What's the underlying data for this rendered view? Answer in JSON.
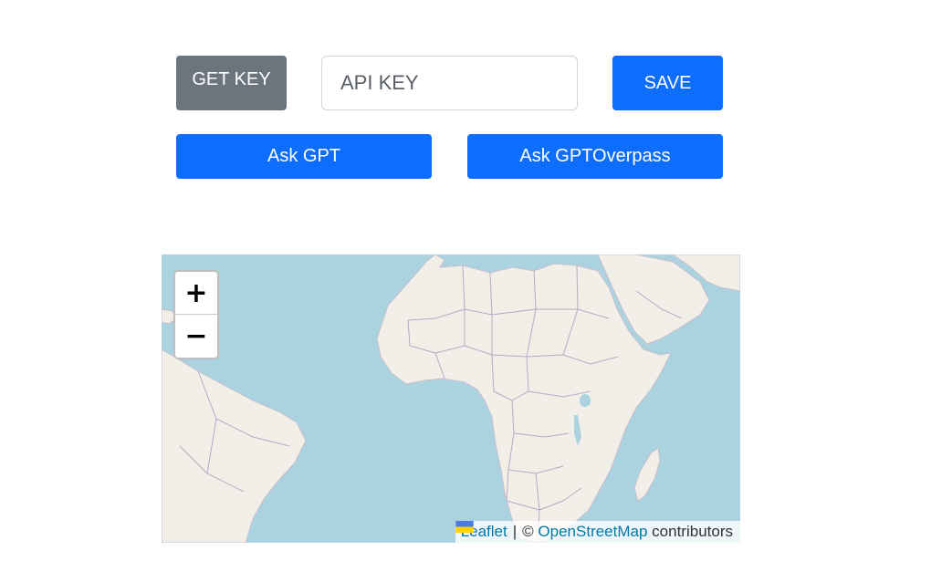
{
  "toolbar": {
    "get_key_label": "GET KEY",
    "api_key_placeholder": "API KEY",
    "api_key_value": "",
    "save_label": "SAVE",
    "ask_gpt_label": "Ask GPT",
    "ask_overpass_label": "Ask GPTOverpass"
  },
  "map": {
    "zoom_in_label": "+",
    "zoom_out_label": "−",
    "attribution": {
      "leaflet_label": "Leaflet",
      "separator": "|",
      "copyright": "©",
      "osm_label": "OpenStreetMap",
      "suffix": "contributors"
    },
    "colors": {
      "water": "#aad3df",
      "land": "#f2efe9",
      "border": "#b9a8c6"
    }
  },
  "colors": {
    "primary": "#0d6efd",
    "secondary": "#6c757d"
  }
}
